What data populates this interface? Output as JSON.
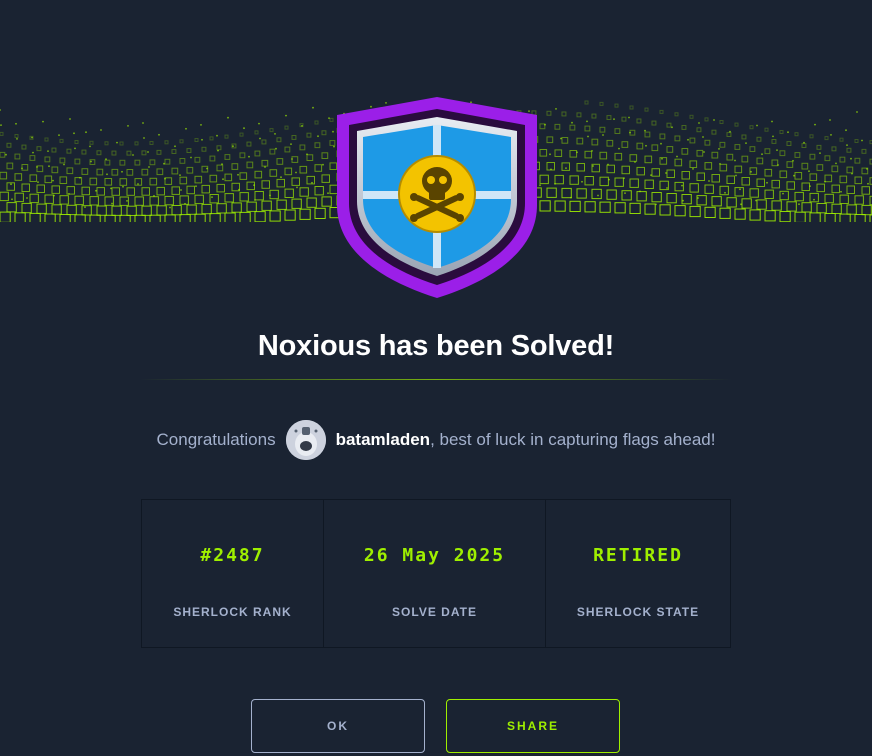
{
  "modal": {
    "title": "Noxious has been Solved!",
    "congrats_prefix": "Congratulations",
    "username": "batamladen",
    "congrats_suffix": ", best of luck in capturing flags ahead!",
    "stats": [
      {
        "value": "#2487",
        "label": "SHERLOCK RANK"
      },
      {
        "value": "26 May 2025",
        "label": "SOLVE DATE"
      },
      {
        "value": "RETIRED",
        "label": "SHERLOCK STATE"
      }
    ],
    "buttons": {
      "ok": "OK",
      "share": "SHARE"
    }
  },
  "colors": {
    "background": "#1a2332",
    "accent_green": "#9fef00",
    "shield_purple": "#9b1fe8",
    "windows_blue": "#1e9ae6",
    "skull_badge": "#f3c300",
    "text_muted": "#a4b1cd"
  },
  "icons": [
    "windows-logo-icon",
    "skull-crossbones-icon",
    "avatar-icon"
  ]
}
